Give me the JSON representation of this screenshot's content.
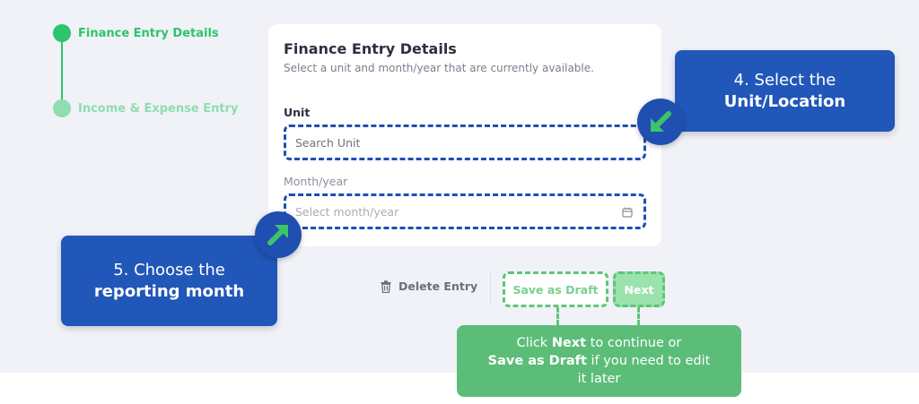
{
  "stepper": {
    "steps": [
      {
        "label": "Finance Entry Details",
        "state": "active"
      },
      {
        "label": "Income & Expense Entry",
        "state": "inactive"
      }
    ],
    "active_color": "#2ec36d",
    "inactive_color": "#8fddb0"
  },
  "card": {
    "title": "Finance Entry Details",
    "subtitle": "Select a unit and month/year that are currently available.",
    "unit_label": "Unit",
    "unit_placeholder": "Search Unit",
    "month_label": "Month/year",
    "month_placeholder": "Select month/year",
    "calendar_icon": "calendar-icon"
  },
  "actions": {
    "delete_label": "Delete Entry",
    "delete_icon": "trash-icon",
    "draft_label": "Save as Draft",
    "next_label": "Next"
  },
  "callouts": {
    "unit": {
      "line1": "4. Select the",
      "line2": "Unit/Location",
      "arrow_icon": "arrow-down-left-icon"
    },
    "month": {
      "line1": "5. Choose the",
      "line2": "reporting month",
      "arrow_icon": "arrow-up-right-icon"
    },
    "next": {
      "t1": "Click ",
      "b1": "Next",
      "t2": " to continue or",
      "b2": "Save as Draft",
      "t3": " if you need to edit",
      "t4": "it later"
    }
  },
  "colors": {
    "callout_blue": "#2157b8",
    "callout_green": "#5cbd78",
    "arrow_green": "#3fc36a",
    "dashed_blue": "#1e4fb3"
  }
}
